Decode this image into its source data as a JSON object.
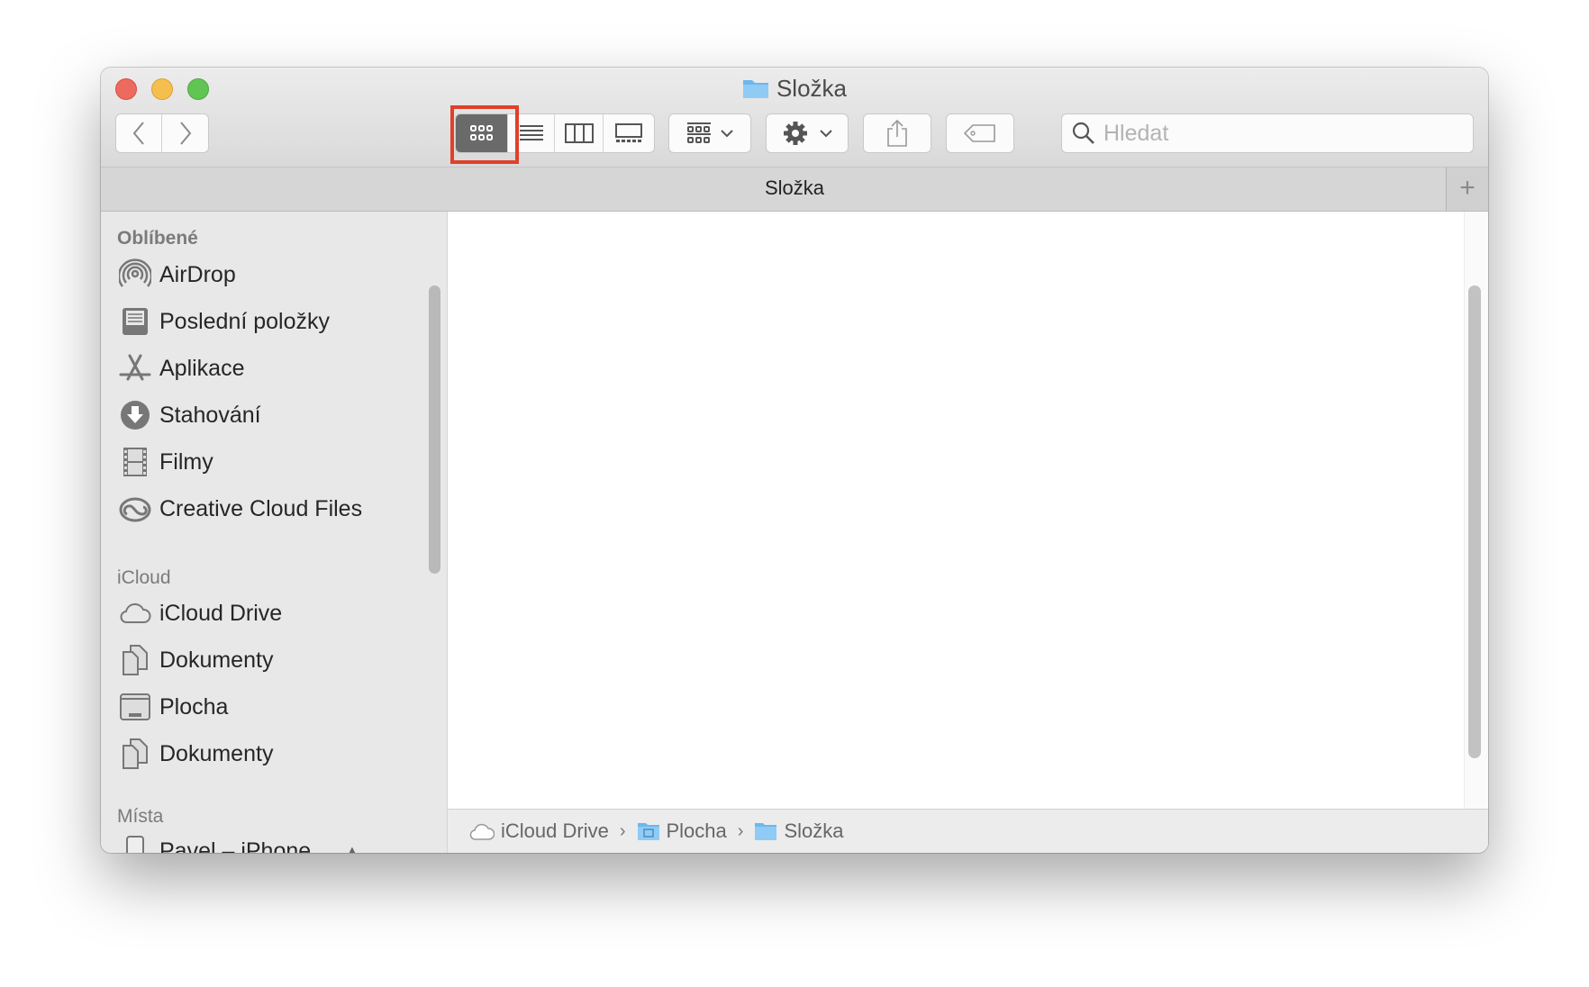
{
  "window": {
    "title": "Složka",
    "tab_title": "Složka"
  },
  "toolbar": {
    "back": "back",
    "forward": "forward",
    "view_modes": [
      "icon-view",
      "list-view",
      "column-view",
      "gallery-view"
    ],
    "selected_view": "icon-view",
    "search_placeholder": "Hledat"
  },
  "sidebar": {
    "sections": [
      {
        "header": "Oblíbené",
        "items": [
          {
            "label": "AirDrop",
            "icon": "airdrop-icon"
          },
          {
            "label": "Poslední položky",
            "icon": "recents-icon"
          },
          {
            "label": "Aplikace",
            "icon": "applications-icon"
          },
          {
            "label": "Stahování",
            "icon": "downloads-icon"
          },
          {
            "label": "Filmy",
            "icon": "movies-icon"
          },
          {
            "label": "Creative Cloud Files",
            "icon": "creative-cloud-icon"
          }
        ]
      },
      {
        "header": "iCloud",
        "items": [
          {
            "label": "iCloud Drive",
            "icon": "cloud-icon"
          },
          {
            "label": "Dokumenty",
            "icon": "documents-icon"
          },
          {
            "label": "Plocha",
            "icon": "desktop-icon"
          },
          {
            "label": "Dokumenty",
            "icon": "documents-icon"
          }
        ]
      },
      {
        "header": "Místa",
        "items": [
          {
            "label": "Pavel – iPhone",
            "icon": "iphone-icon"
          }
        ]
      }
    ]
  },
  "path_bar": [
    "iCloud Drive",
    "Plocha",
    "Složka"
  ],
  "colors": {
    "close": "#ed6a5e",
    "minimize": "#f5bf4f",
    "zoom": "#61c554",
    "highlight": "#e0402a",
    "folder": "#6cb8ee"
  }
}
